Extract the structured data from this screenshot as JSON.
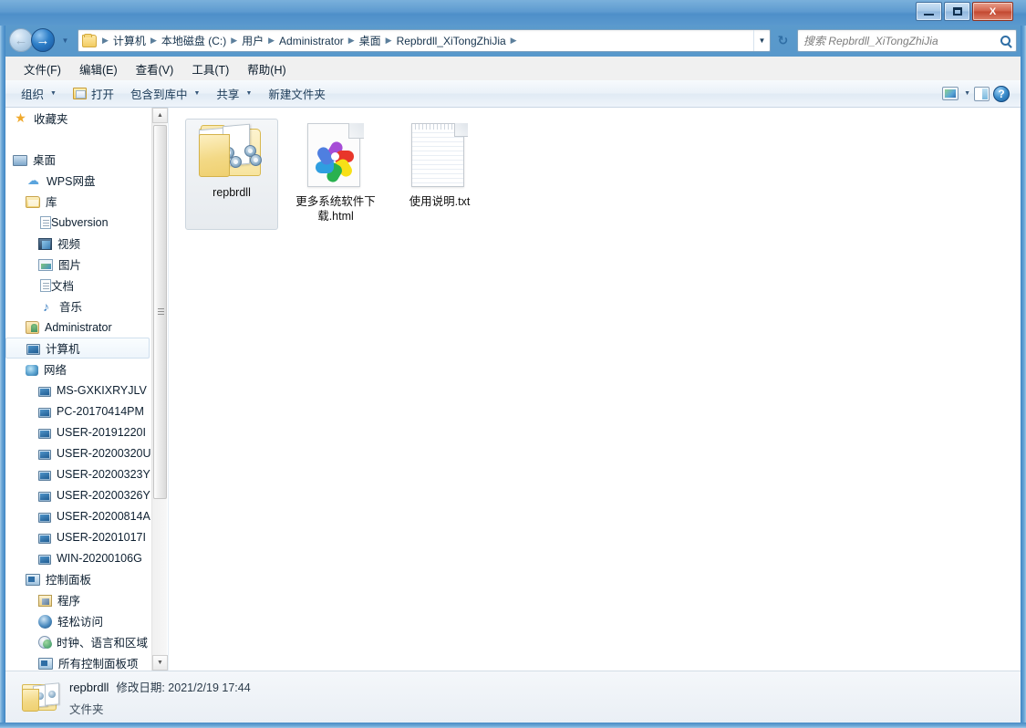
{
  "window": {
    "minimize_label": "最小化",
    "maximize_label": "最大化",
    "close_label": "X"
  },
  "nav": {
    "back_label": "←",
    "forward_label": "→",
    "history_caret": "▼",
    "refresh_label": "↻"
  },
  "address": {
    "folder_icon": "folder-icon",
    "separator": "▶",
    "dropdown_caret": "▼",
    "crumbs": [
      "计算机",
      "本地磁盘 (C:)",
      "用户",
      "Administrator",
      "桌面",
      "Repbrdll_XiTongZhiJia"
    ]
  },
  "search": {
    "placeholder": "搜索 Repbrdll_XiTongZhiJia",
    "value": ""
  },
  "menubar": {
    "items": [
      {
        "label": "文件(F)"
      },
      {
        "label": "编辑(E)"
      },
      {
        "label": "查看(V)"
      },
      {
        "label": "工具(T)"
      },
      {
        "label": "帮助(H)"
      }
    ]
  },
  "toolbar": {
    "organize_label": "组织",
    "open_label": "打开",
    "include_label": "包含到库中",
    "share_label": "共享",
    "newfolder_label": "新建文件夹",
    "caret": "▼",
    "view_options_caret": "▼",
    "help_label": "?"
  },
  "sidebar": {
    "items": [
      {
        "label": "收藏夹",
        "icon": "star-icon",
        "indent": 0,
        "selected": false,
        "gap_after": true
      },
      {
        "label": "桌面",
        "icon": "desktop-icon",
        "indent": 0,
        "selected": false
      },
      {
        "label": "WPS网盘",
        "icon": "cloud-icon",
        "indent": 1,
        "selected": false
      },
      {
        "label": "库",
        "icon": "library-icon",
        "indent": 1,
        "selected": false
      },
      {
        "label": "Subversion",
        "icon": "subversion-icon",
        "indent": 2,
        "selected": false
      },
      {
        "label": "视频",
        "icon": "video-icon",
        "indent": 2,
        "selected": false
      },
      {
        "label": "图片",
        "icon": "pictures-icon",
        "indent": 2,
        "selected": false
      },
      {
        "label": "文档",
        "icon": "documents-icon",
        "indent": 2,
        "selected": false
      },
      {
        "label": "音乐",
        "icon": "music-icon",
        "indent": 2,
        "selected": false
      },
      {
        "label": "Administrator",
        "icon": "user-icon",
        "indent": 1,
        "selected": false
      },
      {
        "label": "计算机",
        "icon": "computer-icon",
        "indent": 1,
        "selected": true
      },
      {
        "label": "网络",
        "icon": "network-icon",
        "indent": 1,
        "selected": false
      },
      {
        "label": "MS-GXKIXRYJLV",
        "icon": "network-pc-icon",
        "indent": 2,
        "selected": false
      },
      {
        "label": "PC-20170414PM",
        "icon": "network-pc-icon",
        "indent": 2,
        "selected": false
      },
      {
        "label": "USER-20191220I",
        "icon": "network-pc-icon",
        "indent": 2,
        "selected": false
      },
      {
        "label": "USER-20200320U",
        "icon": "network-pc-icon",
        "indent": 2,
        "selected": false
      },
      {
        "label": "USER-20200323Y",
        "icon": "network-pc-icon",
        "indent": 2,
        "selected": false
      },
      {
        "label": "USER-20200326Y",
        "icon": "network-pc-icon",
        "indent": 2,
        "selected": false
      },
      {
        "label": "USER-20200814A",
        "icon": "network-pc-icon",
        "indent": 2,
        "selected": false
      },
      {
        "label": "USER-20201017I",
        "icon": "network-pc-icon",
        "indent": 2,
        "selected": false
      },
      {
        "label": "WIN-20200106G",
        "icon": "network-pc-icon",
        "indent": 2,
        "selected": false
      },
      {
        "label": "控制面板",
        "icon": "control-panel-icon",
        "indent": 1,
        "selected": false
      },
      {
        "label": "程序",
        "icon": "programs-icon",
        "indent": 2,
        "selected": false
      },
      {
        "label": "轻松访问",
        "icon": "ease-of-access-icon",
        "indent": 2,
        "selected": false
      },
      {
        "label": "时钟、语言和区域",
        "icon": "clock-language-region-icon",
        "indent": 2,
        "selected": false
      },
      {
        "label": "所有控制面板项",
        "icon": "control-panel-icon",
        "indent": 2,
        "selected": false
      }
    ],
    "scroll_up_caret": "▲",
    "scroll_down_caret": "▼"
  },
  "files": [
    {
      "name": "repbrdll",
      "type": "folder",
      "selected": true
    },
    {
      "name": "更多系统软件下载.html",
      "type": "html",
      "selected": false
    },
    {
      "name": "使用说明.txt",
      "type": "txt",
      "selected": false
    }
  ],
  "statusbar": {
    "item_name": "repbrdll",
    "modified_label": "修改日期: 2021/2/19 17:44",
    "item_type": "文件夹"
  },
  "colors": {
    "frame_blue": "#4a8cc4",
    "accent": "#2f6ea5",
    "folder_yellow": "#f3d986",
    "selection": "#e7ebef"
  },
  "pinwheel_petals": [
    {
      "color": "#a64dd6",
      "angle": -60
    },
    {
      "color": "#e8362a",
      "angle": 0
    },
    {
      "color": "#f7e017",
      "angle": 60
    },
    {
      "color": "#29b14f",
      "angle": 120
    },
    {
      "color": "#2f9ee0",
      "angle": 180
    },
    {
      "color": "#4f7fe0",
      "angle": 240
    }
  ]
}
